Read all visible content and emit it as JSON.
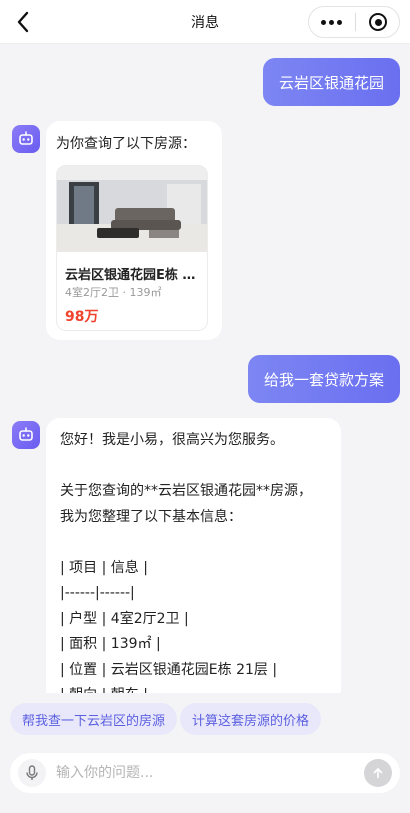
{
  "header": {
    "title": "消息"
  },
  "messages": {
    "user1": "云岩区银通花园",
    "bot1_intro": "为你查询了以下房源：",
    "listing": {
      "title": "云岩区银通花园E栋 1...",
      "specs": "4室2厅2卫 · 139㎡",
      "price": "98万"
    },
    "user2": "给我一套贷款方案",
    "bot2_lines": [
      "您好！我是小易，很高兴为您服务。",
      "",
      "关于您查询的**云岩区银通花园**房源，",
      "我为您整理了以下基本信息：",
      "",
      "| 项目 | 信息 |",
      "|------|------|",
      "| 户型 | 4室2厅2卫 |",
      "| 面积 | 139㎡ |",
      "| 位置 | 云岩区银通花园E栋 21层 |",
      "| 朝向 | 朝东 |"
    ]
  },
  "quick_replies": [
    "帮我查一下云岩区的房源",
    "计算这套房源的价格"
  ],
  "input": {
    "placeholder": "输入你的问题..."
  },
  "colors": {
    "accent": "#6a6ff0",
    "price": "#f0442e",
    "chip_bg": "#e9e8fb"
  },
  "icons": {
    "back": "chevron-left-icon",
    "more": "more-dots-icon",
    "close": "target-icon",
    "bot": "robot-icon",
    "mic": "microphone-icon",
    "send": "arrow-up-icon"
  }
}
